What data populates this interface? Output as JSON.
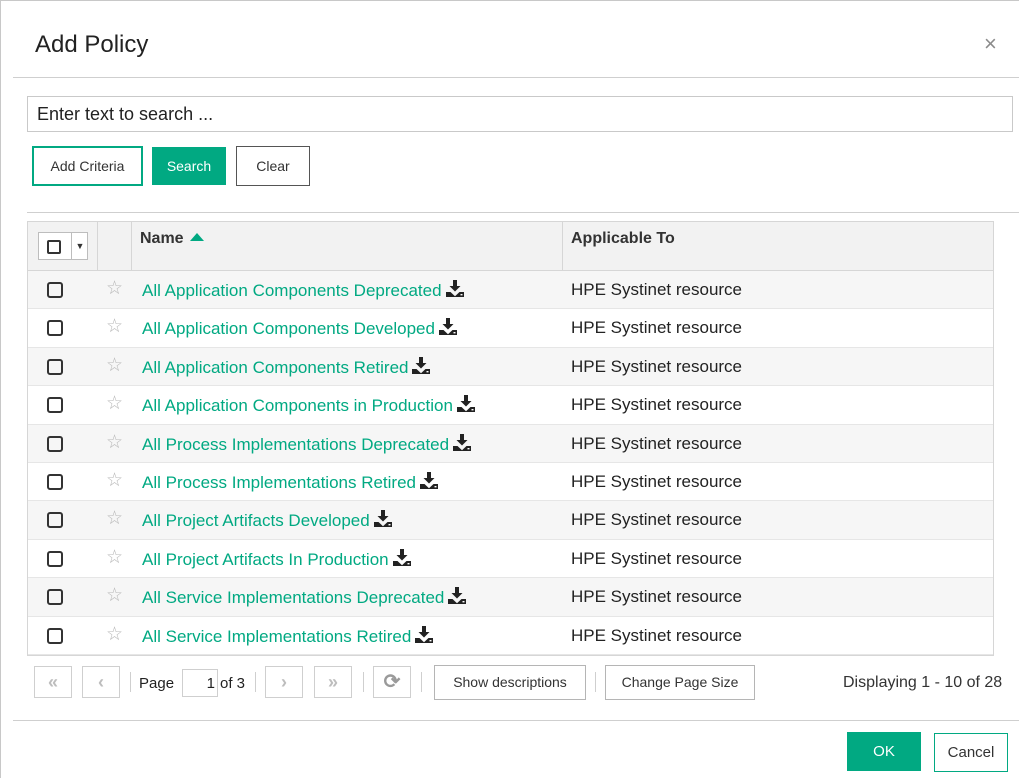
{
  "dialog": {
    "title": "Add Policy",
    "close_glyph": "×"
  },
  "search": {
    "placeholder": "Enter text to search ..."
  },
  "toolbar": {
    "add_criteria": "Add Criteria",
    "search": "Search",
    "clear": "Clear"
  },
  "table": {
    "columns": {
      "name": "Name",
      "applicable_to": "Applicable To"
    },
    "sort": "ascending",
    "rows": [
      {
        "name": "All Application Components Deprecated",
        "applicable_to": "HPE Systinet resource"
      },
      {
        "name": "All Application Components Developed",
        "applicable_to": "HPE Systinet resource"
      },
      {
        "name": "All Application Components Retired",
        "applicable_to": "HPE Systinet resource"
      },
      {
        "name": "All Application Components in Production",
        "applicable_to": "HPE Systinet resource"
      },
      {
        "name": "All Process Implementations Deprecated",
        "applicable_to": "HPE Systinet resource"
      },
      {
        "name": "All Process Implementations Retired",
        "applicable_to": "HPE Systinet resource"
      },
      {
        "name": "All Project Artifacts Developed",
        "applicable_to": "HPE Systinet resource"
      },
      {
        "name": "All Project Artifacts In Production",
        "applicable_to": "HPE Systinet resource"
      },
      {
        "name": "All Service Implementations Deprecated",
        "applicable_to": "HPE Systinet resource"
      },
      {
        "name": "All Service Implementations Retired",
        "applicable_to": "HPE Systinet resource"
      }
    ]
  },
  "pagination": {
    "page_label": "Page",
    "current_page": "1",
    "of_label": "of 3",
    "show_descriptions": "Show descriptions",
    "change_page_size": "Change Page Size",
    "displaying": "Displaying 1 - 10 of 28"
  },
  "footer": {
    "ok": "OK",
    "cancel": "Cancel"
  },
  "colors": {
    "accent": "#01a982",
    "header_bg": "#f2f2f2",
    "row_alt": "#f6f6f6"
  },
  "icons": [
    "close-icon",
    "star-icon",
    "download-icon",
    "sort-ascending-icon",
    "first-page-icon",
    "prev-page-icon",
    "next-page-icon",
    "last-page-icon",
    "refresh-icon",
    "dropdown-caret-icon"
  ]
}
